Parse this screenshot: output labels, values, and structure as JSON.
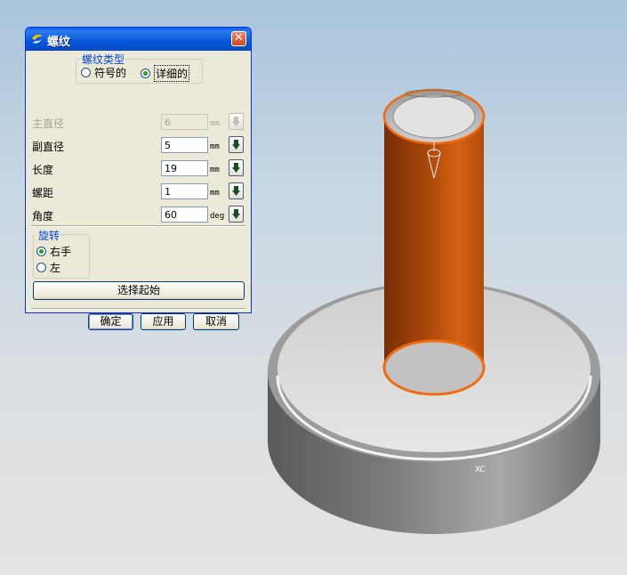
{
  "dialog": {
    "title": "螺纹",
    "close_icon": "close-icon",
    "thread_type": {
      "legend": "螺纹类型",
      "options": [
        {
          "label": "符号的",
          "selected": false
        },
        {
          "label": "详细的",
          "selected": true
        }
      ]
    },
    "fields": [
      {
        "label": "主直径",
        "value": "6",
        "unit": "mm",
        "enabled": false
      },
      {
        "label": "副直径",
        "value": "5",
        "unit": "mm",
        "enabled": true
      },
      {
        "label": "长度",
        "value": "19",
        "unit": "mm",
        "enabled": true
      },
      {
        "label": "螺距",
        "value": "1",
        "unit": "mm",
        "enabled": true
      },
      {
        "label": "角度",
        "value": "60",
        "unit": "deg",
        "enabled": true
      }
    ],
    "rotation": {
      "legend": "旋转",
      "options": [
        {
          "label": "右手",
          "selected": true
        },
        {
          "label": "左",
          "selected": false
        }
      ]
    },
    "select_start_button": "选择起始",
    "ok_button": "确定",
    "apply_button": "应用",
    "cancel_button": "取消"
  },
  "viewport": {
    "axis_label": "XC",
    "highlight_color": "#f06a10",
    "cylinder_color": "#c85a12"
  }
}
